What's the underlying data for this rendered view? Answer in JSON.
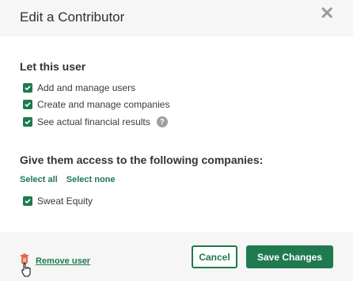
{
  "dialog": {
    "title": "Edit a Contributor",
    "close_icon": "close-icon"
  },
  "permissions": {
    "heading": "Let this user",
    "items": [
      {
        "label": "Add and manage users",
        "checked": true
      },
      {
        "label": "Create and manage companies",
        "checked": true
      },
      {
        "label": "See actual financial results",
        "checked": true,
        "help": "?"
      }
    ]
  },
  "companies": {
    "heading": "Give them access to the following companies:",
    "select_all": "Select all",
    "select_none": "Select none",
    "items": [
      {
        "label": "Sweat Equity",
        "checked": true
      }
    ]
  },
  "footer": {
    "remove_label": "Remove user",
    "cancel_label": "Cancel",
    "save_label": "Save Changes"
  },
  "colors": {
    "accent": "#1f7a4f",
    "danger_icon": "#e06b4a"
  }
}
